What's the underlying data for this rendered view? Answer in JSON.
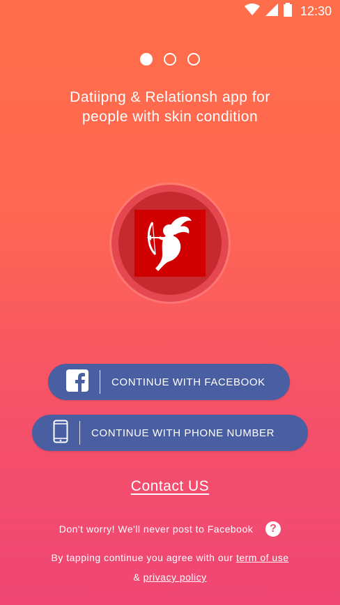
{
  "status_bar": {
    "time": "12:30"
  },
  "onboarding": {
    "page_count": 3,
    "active_page": 1,
    "tagline_line1": "Datiipng & Relationsh app for",
    "tagline_line2": "people with skin condition"
  },
  "buttons": {
    "facebook_label": "CONTINUE WITH FACEBOOK",
    "phone_label": "CONTINUE WITH PHONE NUMBER"
  },
  "contact": {
    "label": "Contact US"
  },
  "note": {
    "text": "Don't worry! We'll never post to Facebook"
  },
  "terms": {
    "prefix": "By tapping continue you agree with our ",
    "term_link": "term of use",
    "amp": "& ",
    "privacy_link": "privacy policy"
  },
  "colors": {
    "gradient_top": "#ff6e4a",
    "gradient_bottom": "#ef4674",
    "button": "#4a5fa2",
    "logo_red": "#d10000"
  },
  "icons": [
    "wifi-icon",
    "cell-signal-icon",
    "battery-icon",
    "facebook-icon",
    "phone-icon",
    "cupid-icon",
    "help-icon"
  ]
}
